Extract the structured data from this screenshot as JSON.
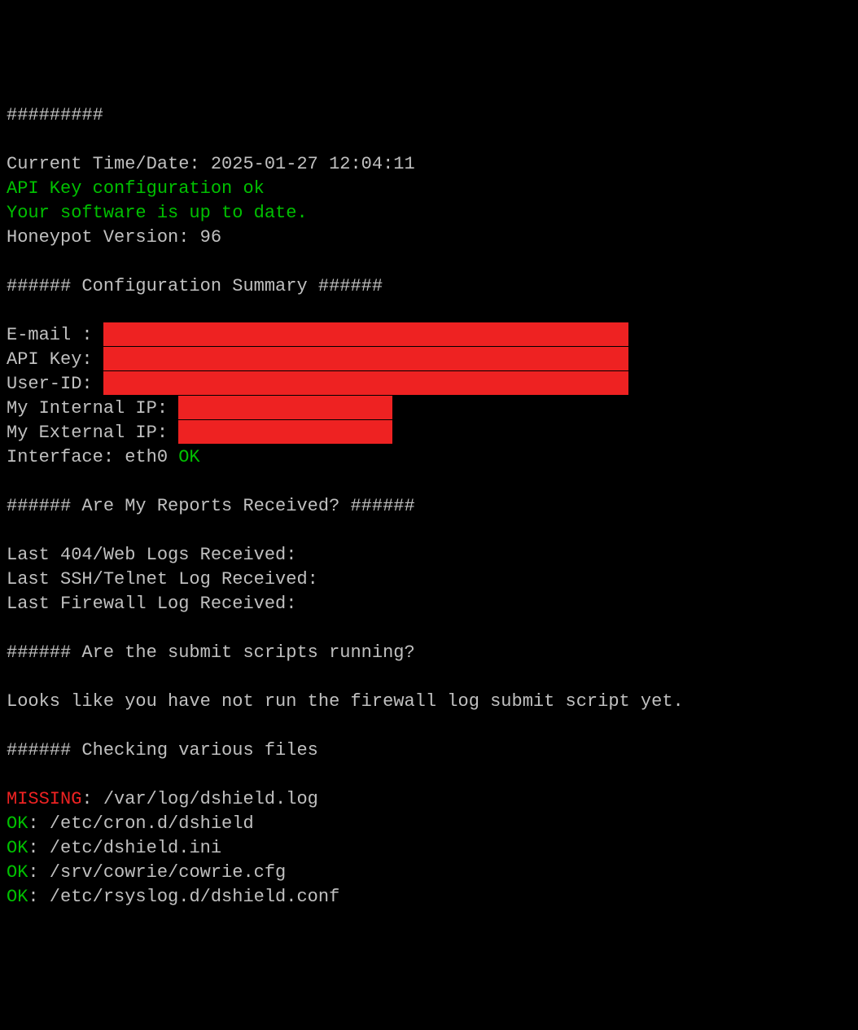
{
  "hashes_top": "#########",
  "current_time_label": "Current Time/Date: ",
  "current_time_value": "2025-01-27 12:04:11",
  "api_config_ok": "API Key configuration ok",
  "software_uptodate": "Your software is up to date.",
  "honeypot_version_label": "Honeypot Version: ",
  "honeypot_version_value": "96",
  "config_summary_header": "###### Configuration Summary ######",
  "email_label": "E-mail : ",
  "apikey_label": "API Key: ",
  "userid_label": "User-ID: ",
  "internal_ip_label": "My Internal IP: ",
  "external_ip_label": "My External IP: ",
  "interface_label": "Interface: eth0 ",
  "interface_status": "OK",
  "reports_header": "###### Are My Reports Received? ######",
  "last_404": "Last 404/Web Logs Received:",
  "last_ssh": "Last SSH/Telnet Log Received:",
  "last_firewall": "Last Firewall Log Received:",
  "submit_scripts_header": "###### Are the submit scripts running?",
  "firewall_script_msg": "Looks like you have not run the firewall log submit script yet.",
  "checking_files_header": "###### Checking various files",
  "missing_label": "MISSING",
  "missing_file": ": /var/log/dshield.log",
  "ok_label": "OK",
  "files": [
    ": /etc/cron.d/dshield",
    ": /etc/dshield.ini",
    ": /srv/cowrie/cowrie.cfg",
    ": /etc/rsyslog.d/dshield.conf"
  ]
}
